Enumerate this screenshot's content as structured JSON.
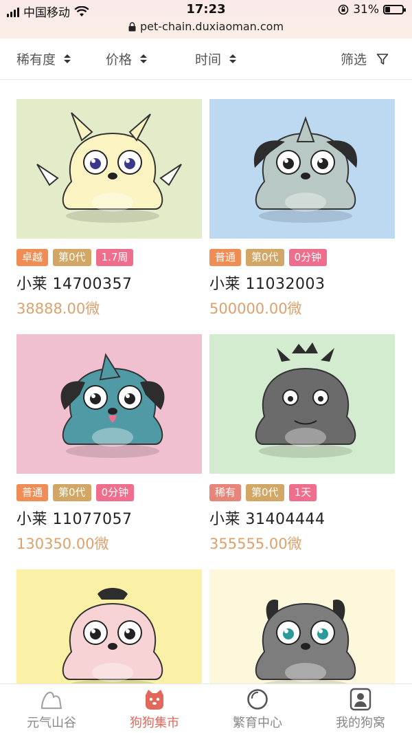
{
  "status_bar": {
    "carrier": "中国移动",
    "time": "17:23",
    "battery_percent": "31%",
    "battery_level": 0.31,
    "url": "pet-chain.duxiaoman.com"
  },
  "filters": {
    "rarity": "稀有度",
    "price": "价格",
    "time": "时间",
    "screen": "筛选"
  },
  "pets": [
    {
      "rarity": "卓越",
      "generation": "第0代",
      "cooldown": "1.7周",
      "name": "小莱 14700357",
      "price": "38888.00微",
      "bg": "#e2ecc8",
      "body": "#fbf4c2"
    },
    {
      "rarity": "普通",
      "generation": "第0代",
      "cooldown": "0分钟",
      "name": "小莱 11032003",
      "price": "500000.00微",
      "bg": "#bdd9f1",
      "body": "#b8c8c4"
    },
    {
      "rarity": "普通",
      "generation": "第0代",
      "cooldown": "0分钟",
      "name": "小莱 11077057",
      "price": "130350.00微",
      "bg": "#f0bfd0",
      "body": "#4f9aa5"
    },
    {
      "rarity": "稀有",
      "generation": "第0代",
      "cooldown": "1天",
      "name": "小莱 31404444",
      "price": "355555.00微",
      "bg": "#d3ebcf",
      "body": "#6b6b6b"
    },
    {
      "rarity": "",
      "generation": "",
      "cooldown": "",
      "name": "",
      "price": "",
      "bg": "#fbf1a6",
      "body": "#f8d3d5"
    },
    {
      "rarity": "",
      "generation": "",
      "cooldown": "",
      "name": "",
      "price": "",
      "bg": "#fdf8dc",
      "body": "#7d7d7d"
    }
  ],
  "tabs": {
    "valley": "元气山谷",
    "market": "狗狗集市",
    "breeding": "繁育中心",
    "my_kennel": "我的狗窝",
    "active": "market"
  },
  "colors": {
    "accent": "#e2685c",
    "price": "#dba26d"
  }
}
